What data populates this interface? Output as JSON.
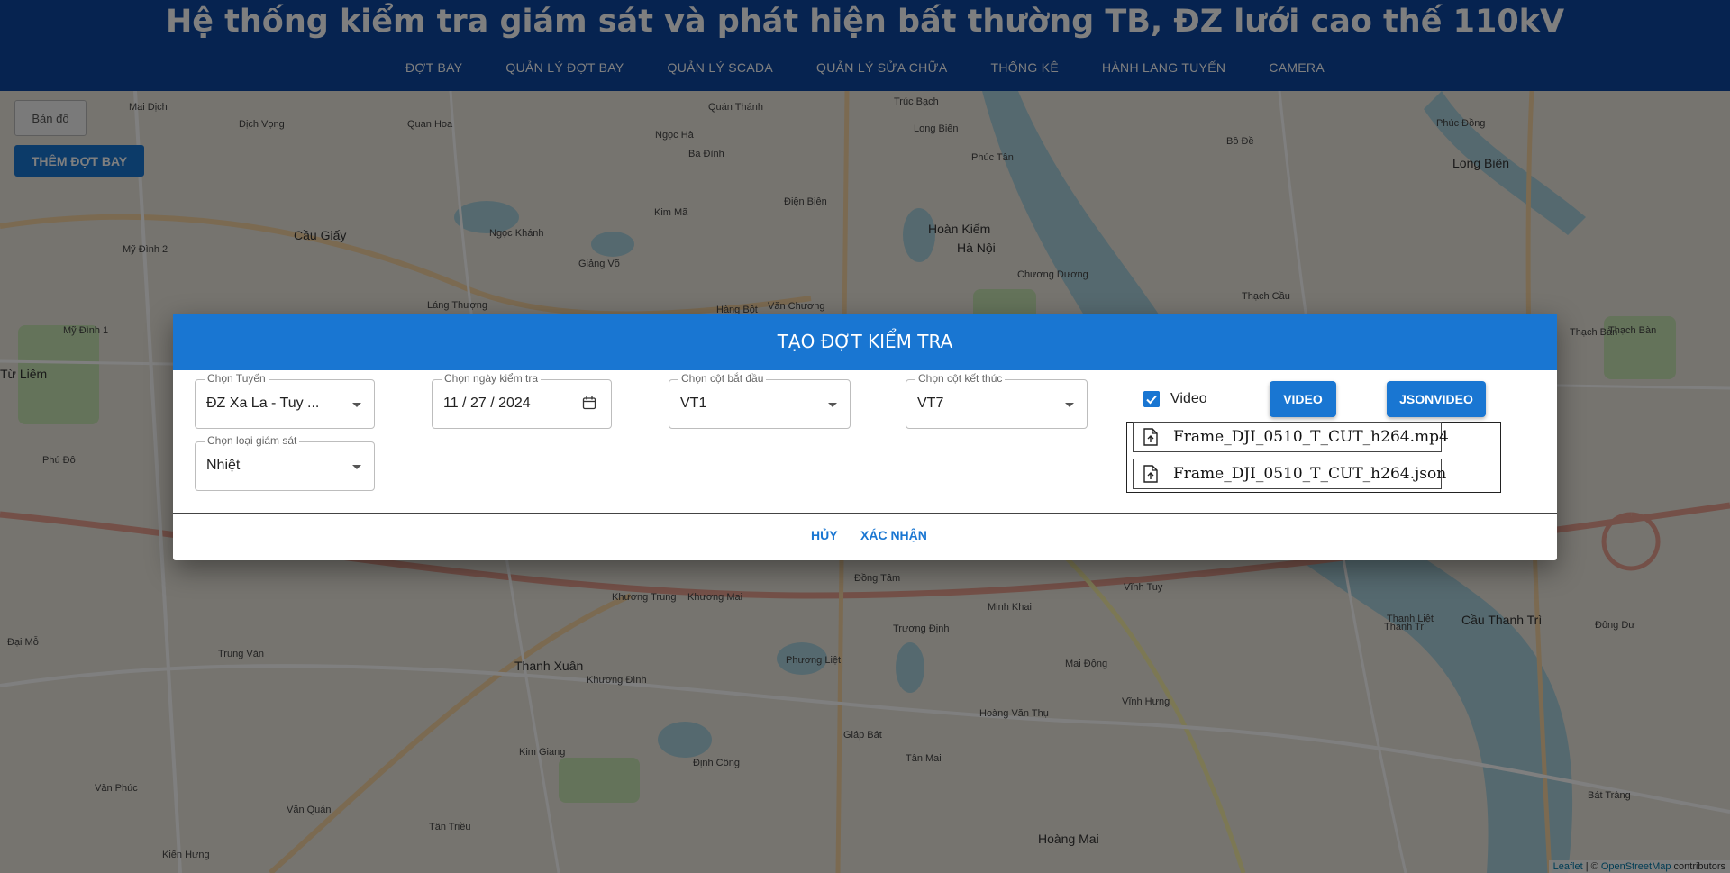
{
  "header": {
    "title": "Hệ thống kiểm tra giám sát và phát hiện bất thường TB, ĐZ lưới cao thế 110kV",
    "nav": [
      "ĐỢT BAY",
      "QUẢN LÝ ĐỢT BAY",
      "QUẢN LÝ SCADA",
      "QUẢN LÝ SỬA CHỮA",
      "THỐNG KÊ",
      "HÀNH LANG TUYẾN",
      "CAMERA"
    ]
  },
  "map": {
    "map_button": "Bản đồ",
    "add_button": "THÊM ĐỢT BAY",
    "labels": [
      "Mai Dịch",
      "Dịch Vọng",
      "Quan Hoa",
      "Ngọc Hà",
      "Ba Đình",
      "Quán Thánh",
      "Trúc Bạch",
      "Long Biên",
      "Phúc Tân",
      "Bồ Đề",
      "Phúc Đồng",
      "Cầu Giấy",
      "Ngọc Khánh",
      "Giảng Võ",
      "Kim Mã",
      "Điện Biên",
      "Hoàn Kiếm",
      "Hà Nội",
      "Chương Dương",
      "Thạch Cầu",
      "Mỹ Đình 2",
      "Mỹ Đình 1",
      "Từ Liêm",
      "Phú Đô",
      "Láng Thượng",
      "Hàng Bột",
      "Văn Chương",
      "Thạch Bàn",
      "Thanh Xuân",
      "Khương Trung",
      "Khương Mai",
      "Đồng Tâm",
      "Minh Khai",
      "Vĩnh Tuy",
      "Trương Định",
      "Phương Liệt",
      "Khương Đình",
      "Kim Giang",
      "Tân Mai",
      "Hoàng Văn Thụ",
      "Vĩnh Hưng",
      "Mai Động",
      "Đại Mỗ",
      "Trung Văn",
      "Thanh Liệt",
      "Văn Quán",
      "Tân Triều",
      "Giáp Bát",
      "Định Công",
      "Hoàng Mai",
      "Thanh Trì",
      "Cầu Thanh Trì",
      "Đông Dư",
      "Bát Tràng",
      "Văn Phúc",
      "Kiến Hưng",
      "Long Biên",
      "Thạch Bàn"
    ],
    "attribution_leaflet": "Leaflet",
    "attribution_sep": " | © ",
    "attribution_osm": "OpenStreetMap",
    "attribution_rest": " contributors"
  },
  "dialog": {
    "title": "TẠO ĐỢT KIỂM TRA",
    "route": {
      "label": "Chọn Tuyến",
      "value": "ĐZ Xa La - Tuy ..."
    },
    "date": {
      "label": "Chọn ngày kiểm tra",
      "value": "11 / 27 / 2024"
    },
    "start_pole": {
      "label": "Chọn cột bắt đầu",
      "value": "VT1"
    },
    "end_pole": {
      "label": "Chọn cột kết thúc",
      "value": "VT7"
    },
    "monitor_type": {
      "label": "Chọn loại giám sát",
      "value": "Nhiệt"
    },
    "video_checkbox": {
      "label": "Video",
      "checked": true
    },
    "video_button": "VIDEO",
    "json_button": "JSONVIDEO",
    "files": [
      "Frame_DJI_0510_T_CUT_h264.mp4",
      "Frame_DJI_0510_T_CUT_h264.json"
    ],
    "cancel": "HỦY",
    "confirm": "XÁC NHẬN"
  },
  "colors": {
    "primary": "#1976d2",
    "header_bg": "#0d47a1",
    "overlay": "rgba(0,0,0,0.5)"
  }
}
